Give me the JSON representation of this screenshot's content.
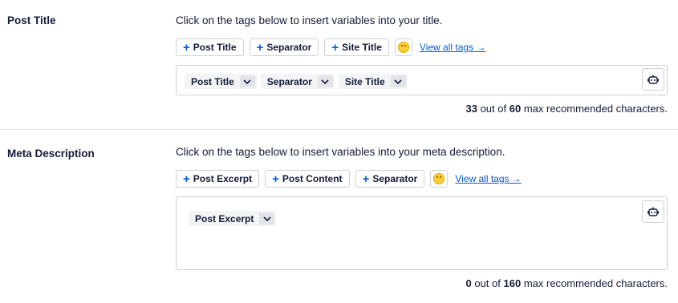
{
  "post_title": {
    "label": "Post Title",
    "description": "Click on the tags below to insert variables into your title.",
    "tag_buttons": [
      "Post Title",
      "Separator",
      "Site Title"
    ],
    "view_all": "View all tags →",
    "tags": [
      "Post Title",
      "Separator",
      "Site Title"
    ],
    "counter": {
      "count": "33",
      "middle": "out of",
      "max": "60",
      "suffix": "max recommended characters."
    }
  },
  "meta_description": {
    "label": "Meta Description",
    "description": "Click on the tags below to insert variables into your meta description.",
    "tag_buttons": [
      "Post Excerpt",
      "Post Content",
      "Separator"
    ],
    "view_all": "View all tags →",
    "tags": [
      "Post Excerpt"
    ],
    "counter": {
      "count": "0",
      "middle": "out of",
      "max": "160",
      "suffix": "max recommended characters."
    }
  },
  "icons": {
    "plus": "+",
    "emoji": "emoji-icon",
    "caret": "chevron-down-icon",
    "ai": "robot-icon"
  },
  "colors": {
    "accent": "#005ae0",
    "text": "#141b38",
    "border": "#d0d1d7",
    "pill_bg": "#f3f4f5"
  }
}
